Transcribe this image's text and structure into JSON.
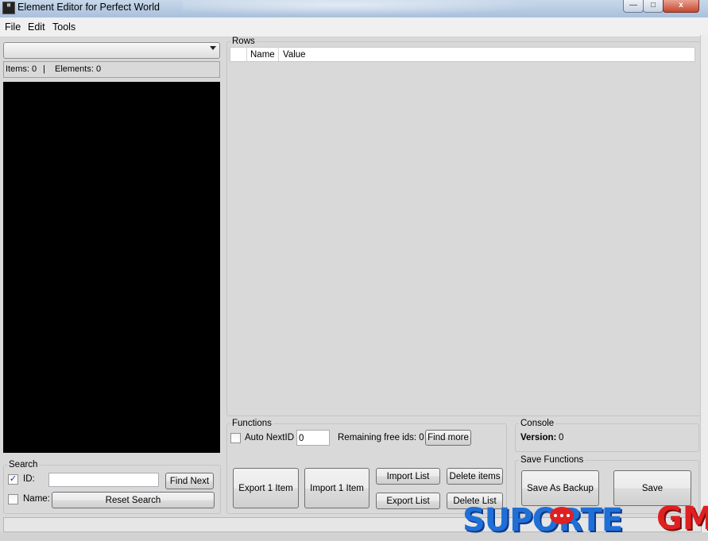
{
  "window": {
    "title": "Element Editor for Perfect World",
    "controls": {
      "minimize": "—",
      "maximize": "□",
      "close": "x"
    }
  },
  "menu": [
    "File",
    "Edit",
    "Tools"
  ],
  "left": {
    "list_selector_value": "",
    "items_label": "Items: 0",
    "separator": "|",
    "elements_label": "Elements: 0"
  },
  "search": {
    "title": "Search",
    "id_label": "ID:",
    "id_checked": true,
    "id_value": "",
    "name_label": "Name:",
    "name_checked": false,
    "find_next": "Find Next",
    "reset_search": "Reset Search"
  },
  "rows": {
    "title": "Rows",
    "columns": [
      "Name",
      "Value"
    ]
  },
  "functions": {
    "title": "Functions",
    "auto_next_id_label": "Auto NextID :",
    "auto_next_id_checked": false,
    "next_id_value": "0",
    "remaining_label": "Remaining free ids: 0",
    "find_more": "Find more",
    "export_item": "Export 1 Item",
    "import_item": "Import 1 Item",
    "import_list": "Import List",
    "export_list": "Export List",
    "delete_items": "Delete items",
    "delete_list": "Delete List"
  },
  "console": {
    "title": "Console",
    "version_label": "Version:",
    "version_value": "0"
  },
  "save_functions": {
    "title": "Save Functions",
    "save_as_backup": "Save As Backup",
    "save": "Save"
  },
  "watermark": {
    "text_blue": "SUPORTE",
    "text_red": "GM"
  }
}
